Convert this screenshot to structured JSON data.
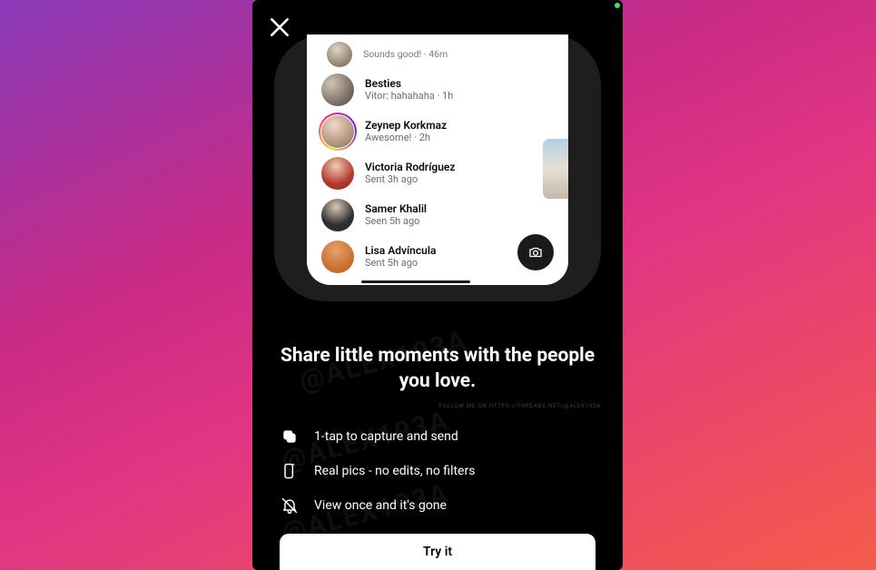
{
  "modal": {
    "watermark_text": "@ALEX193A",
    "follow_line": "FOLLOW ME ON HTTPS://THREADS.NET/@ALEX193A",
    "headline": "Share little moments with the people you love.",
    "features": [
      "1-tap to capture and send",
      "Real pics - no edits, no filters",
      "View once and it's gone"
    ],
    "cta_label": "Try it"
  },
  "preview": {
    "truncated_top": {
      "sub": "Sounds good! · 46m"
    },
    "rows": [
      {
        "name": "Besties",
        "sub": "Vitor: hahahaha · 1h",
        "avatar_css": "background:radial-gradient(circle at 30% 30%,#d0c4b6,#4a4037);",
        "ring": false
      },
      {
        "name": "Zeynep Korkmaz",
        "sub": "Awesome! · 2h",
        "avatar_css": "background:radial-gradient(circle at 40% 30%,#f0d9c8,#8a6b52);",
        "ring": true
      },
      {
        "name": "Victoria Rodríguez",
        "sub": "Sent 3h ago",
        "avatar_css": "background:radial-gradient(circle at 45% 28%,#eecdb8,#b33a2f 60%,#8a2a22);",
        "ring": false
      },
      {
        "name": "Samer Khalil",
        "sub": "Seen 5h ago",
        "avatar_css": "background:radial-gradient(circle at 45% 25%,#d9c8b8,#2e2e2e 60%);",
        "ring": false
      },
      {
        "name": "Lisa Advíncula",
        "sub": "Sent 5h ago",
        "avatar_css": "background:radial-gradient(circle at 45% 30%,#e6a06a,#c76a2d 70%);",
        "ring": false
      }
    ]
  }
}
